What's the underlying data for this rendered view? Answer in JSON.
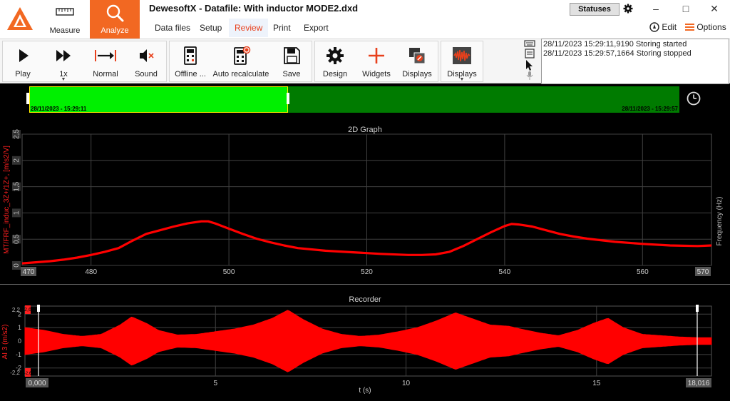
{
  "window": {
    "title": "DewesoftX - Datafile: With inductor MODE2.dxd",
    "statuses_label": "Statuses",
    "edit_label": "Edit",
    "options_label": "Options"
  },
  "modes": [
    {
      "label": "Measure",
      "icon": "ruler-icon",
      "active": false
    },
    {
      "label": "Analyze",
      "icon": "magnifier-icon",
      "active": true
    }
  ],
  "menu": [
    {
      "label": "Data files",
      "active": false
    },
    {
      "label": "Setup",
      "active": false
    },
    {
      "label": "Review",
      "active": true
    },
    {
      "label": "Print",
      "active": false
    },
    {
      "label": "Export",
      "active": false
    }
  ],
  "toolbar": {
    "play_label": "Play",
    "speed_label": "1x",
    "normal_label": "Normal",
    "sound_label": "Sound",
    "offline_label": "Offline ...",
    "recalc_label": "Auto recalculate",
    "save_label": "Save",
    "design_label": "Design",
    "widgets_label": "Widgets",
    "displays_label": "Displays",
    "displays2_label": "Displays"
  },
  "log": [
    "28/11/2023 15:29:11,9190 Storing started",
    "28/11/2023 15:29:57,1664 Storing stopped"
  ],
  "timeline": {
    "start_label": "28/11/2023 - 15:29:11",
    "end_label": "28/11/2023 - 15:29:57",
    "selection_end_fraction": 0.398,
    "selected_color": "#00f000",
    "unselected_color": "#007b00"
  },
  "colors": {
    "accent": "#f26822",
    "trace": "#ff0000",
    "grid": "#404040"
  },
  "chart_data": [
    {
      "type": "line",
      "title": "2D Graph",
      "ylabel": "MT/FRF_induc_3Z+/1Z+, [m/s2/V]",
      "y2label": "Frequency (Hz)",
      "xlim": [
        470,
        570
      ],
      "ylim": [
        0,
        2.5
      ],
      "x_ticks": [
        480,
        500,
        520,
        540,
        560
      ],
      "x_edge_labels": [
        "470",
        "570"
      ],
      "y_ticks": [
        0,
        0.5,
        1,
        1.5,
        2,
        2.5
      ],
      "y_tick_labels": [
        "0",
        "0,5",
        "1",
        "1,5",
        "2",
        "2,5"
      ],
      "grid": true,
      "series": [
        {
          "x": [
            470,
            472,
            474,
            476,
            478,
            480,
            482,
            484,
            486,
            488,
            490,
            492,
            494,
            496,
            497,
            498,
            500,
            502,
            504,
            506,
            508,
            510,
            514,
            518,
            522,
            526,
            528,
            530,
            532,
            534,
            536,
            538,
            540,
            541,
            542,
            544,
            546,
            548,
            550,
            552,
            556,
            560,
            564,
            568,
            570
          ],
          "y": [
            0.04,
            0.06,
            0.08,
            0.11,
            0.15,
            0.2,
            0.26,
            0.33,
            0.47,
            0.6,
            0.67,
            0.74,
            0.8,
            0.84,
            0.84,
            0.8,
            0.7,
            0.6,
            0.51,
            0.44,
            0.38,
            0.33,
            0.28,
            0.25,
            0.22,
            0.2,
            0.2,
            0.21,
            0.26,
            0.37,
            0.5,
            0.63,
            0.75,
            0.79,
            0.78,
            0.74,
            0.67,
            0.6,
            0.55,
            0.51,
            0.45,
            0.41,
            0.38,
            0.37,
            0.38
          ]
        }
      ]
    },
    {
      "type": "line",
      "title": "Recorder",
      "ylabel": "AI 3 (m/s2)",
      "xlabel": "t (s)",
      "xlim": [
        0,
        18.016
      ],
      "ylim": [
        -2.6,
        2.6
      ],
      "x_ticks": [
        5,
        10,
        15
      ],
      "x_edge_labels": [
        "0,000",
        "18,016"
      ],
      "y_ticks": [
        -2,
        -1,
        0,
        1,
        2
      ],
      "y_tick_labels": [
        "-2",
        "-1",
        "0",
        "1",
        "2"
      ],
      "y_top_label": "2,6",
      "y_bottom_label": "-2,6",
      "y_edge_labels": [
        "2,2",
        "-2,2"
      ],
      "grid": true,
      "envelope": {
        "t": [
          0,
          0.5,
          1,
          1.5,
          2,
          2.5,
          2.8,
          3.2,
          3.5,
          4,
          4.5,
          5,
          5.5,
          6,
          6.5,
          6.9,
          7.3,
          7.8,
          8.3,
          8.8,
          9.3,
          9.8,
          10.3,
          10.8,
          11.3,
          11.7,
          12.2,
          12.7,
          13,
          13.5,
          14,
          14.5,
          14.9,
          15.3,
          15.7,
          16.2,
          16.7,
          17.2,
          17.7,
          18.016
        ],
        "amp": [
          1.0,
          0.8,
          0.5,
          0.35,
          0.5,
          1.2,
          1.8,
          1.3,
          0.8,
          0.45,
          0.5,
          0.7,
          0.9,
          1.2,
          1.7,
          2.3,
          1.6,
          0.9,
          0.5,
          0.35,
          0.45,
          0.7,
          1.0,
          1.5,
          2.1,
          1.7,
          1.2,
          1.1,
          0.9,
          0.6,
          0.4,
          0.8,
          1.3,
          1.7,
          1.0,
          0.5,
          0.4,
          0.3,
          0.25,
          0.25
        ]
      }
    }
  ]
}
